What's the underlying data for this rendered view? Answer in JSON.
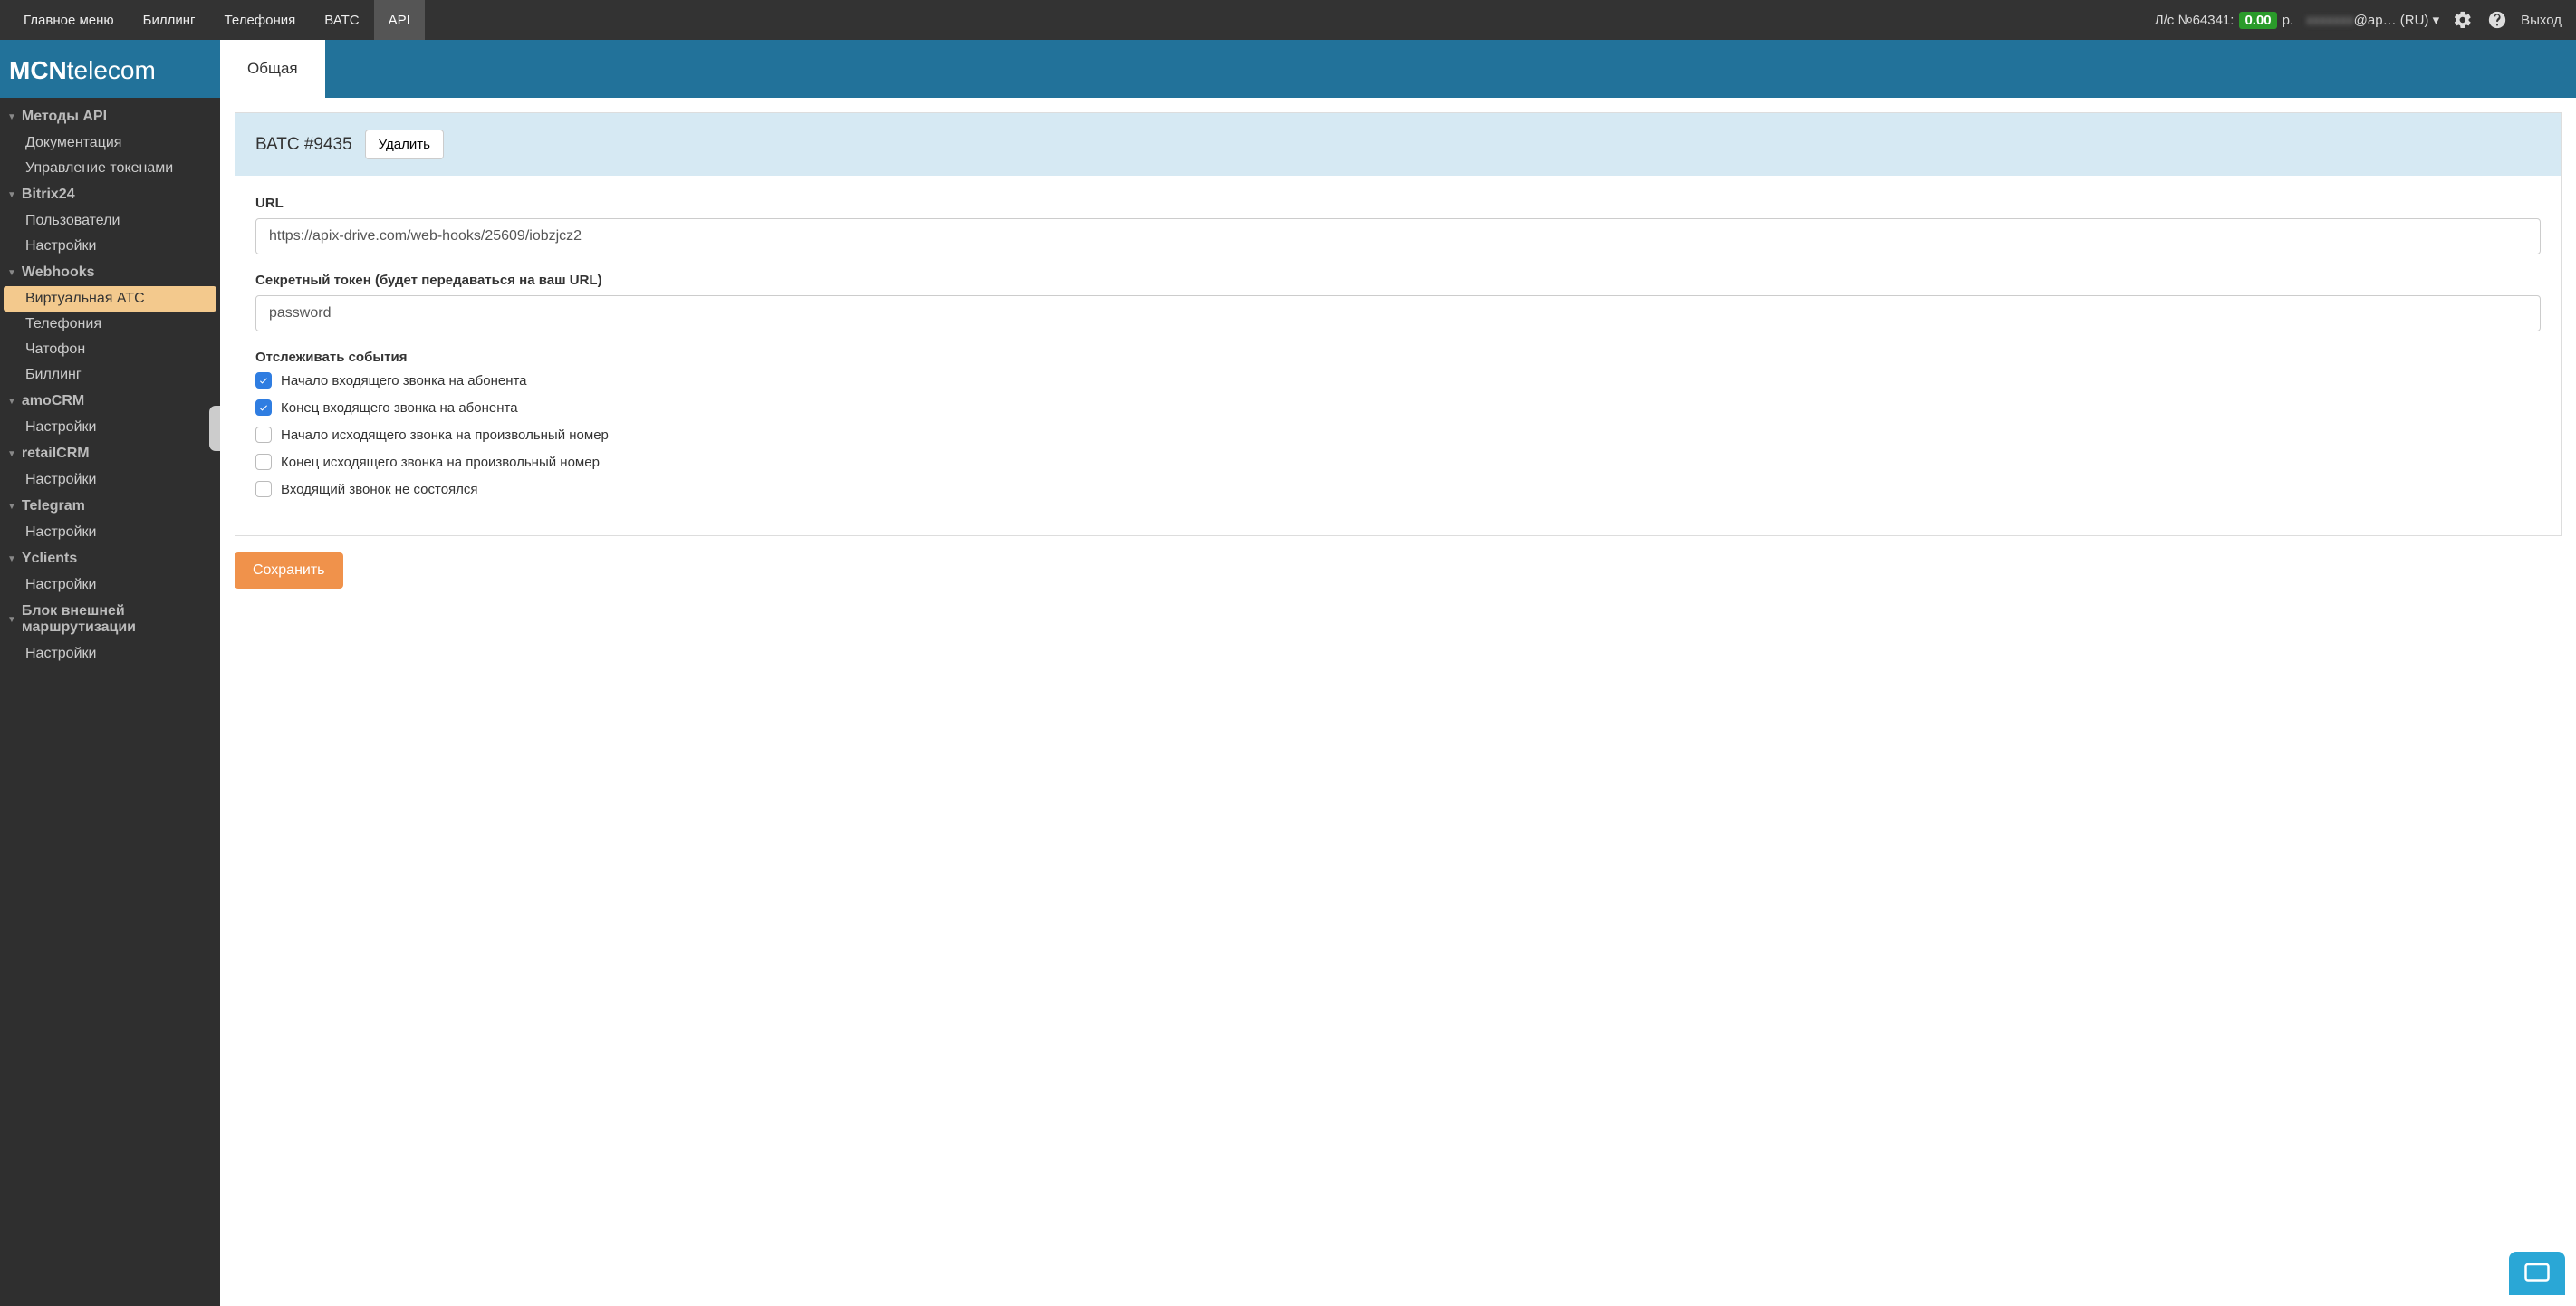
{
  "topbar": {
    "items": [
      {
        "label": "Главное меню"
      },
      {
        "label": "Биллинг"
      },
      {
        "label": "Телефония"
      },
      {
        "label": "ВАТС"
      },
      {
        "label": "API",
        "active": true
      }
    ],
    "account_prefix": "Л/с №64341:",
    "balance": "0.00",
    "balance_suffix": "р.",
    "user": "@ap… (RU)",
    "exit": "Выход"
  },
  "logo": {
    "bold": "MCN",
    "thin": "telecom"
  },
  "tabs": [
    {
      "label": "Общая"
    }
  ],
  "sidebar": [
    {
      "type": "group",
      "label": "Методы API"
    },
    {
      "type": "item",
      "label": "Документация"
    },
    {
      "type": "item",
      "label": "Управление токенами"
    },
    {
      "type": "group",
      "label": "Bitrix24"
    },
    {
      "type": "item",
      "label": "Пользователи"
    },
    {
      "type": "item",
      "label": "Настройки"
    },
    {
      "type": "group",
      "label": "Webhooks"
    },
    {
      "type": "item",
      "label": "Виртуальная АТС",
      "active": true
    },
    {
      "type": "item",
      "label": "Телефония"
    },
    {
      "type": "item",
      "label": "Чатофон"
    },
    {
      "type": "item",
      "label": "Биллинг"
    },
    {
      "type": "group",
      "label": "amoCRM"
    },
    {
      "type": "item",
      "label": "Настройки"
    },
    {
      "type": "group",
      "label": "retailCRM"
    },
    {
      "type": "item",
      "label": "Настройки"
    },
    {
      "type": "group",
      "label": "Telegram"
    },
    {
      "type": "item",
      "label": "Настройки"
    },
    {
      "type": "group",
      "label": "Yclients"
    },
    {
      "type": "item",
      "label": "Настройки"
    },
    {
      "type": "group",
      "label": "Блок внешней маршрутизации"
    },
    {
      "type": "item",
      "label": "Настройки"
    }
  ],
  "panel": {
    "title": "ВАТС #9435",
    "delete": "Удалить",
    "url_label": "URL",
    "url_value": "https://apix-drive.com/web-hooks/25609/iobzjcz2",
    "token_label": "Секретный токен (будет передаваться на ваш URL)",
    "token_value": "password",
    "events_label": "Отслеживать события",
    "events": [
      {
        "label": "Начало входящего звонка на абонента",
        "checked": true
      },
      {
        "label": "Конец входящего звонка на абонента",
        "checked": true
      },
      {
        "label": "Начало исходящего звонка на произвольный номер",
        "checked": false
      },
      {
        "label": "Конец исходящего звонка на произвольный номер",
        "checked": false
      },
      {
        "label": "Входящий звонок не состоялся",
        "checked": false
      }
    ]
  },
  "save": "Сохранить"
}
